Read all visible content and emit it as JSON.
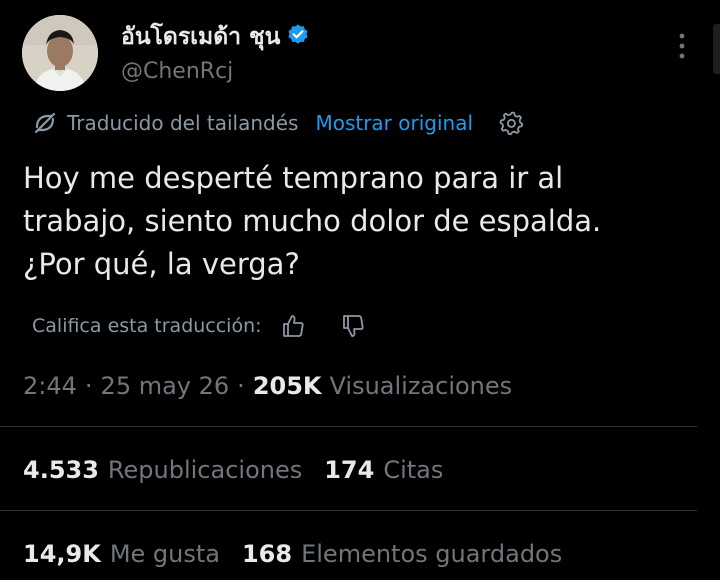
{
  "author": {
    "display_name": "อันโดรเมด้า ชุน",
    "handle": "@ChenRcj",
    "verified": true,
    "avatar_icon": "profile-photo"
  },
  "translation": {
    "translated_from": "Traducido del tailandés",
    "show_original": "Mostrar original",
    "rate_label": "Califica esta traducción:"
  },
  "tweet": {
    "lines": [
      "Hoy me desperté temprano para ir al",
      "trabajo, siento mucho dolor de espalda.",
      "¿Por qué, la verga?"
    ]
  },
  "meta": {
    "time": "2:44",
    "separator": "·",
    "date": "25 may 26",
    "views_count": "205K",
    "views_label": "Visualizaciones"
  },
  "stats": {
    "reposts_count": "4.533",
    "reposts_label": "Republicaciones",
    "quotes_count": "174",
    "quotes_label": "Citas",
    "likes_count": "14,9K",
    "likes_label": "Me gusta",
    "bookmarks_count": "168",
    "bookmarks_label": "Elementos guardados"
  },
  "colors": {
    "background": "#000000",
    "text": "#e7e9ea",
    "secondary_text": "#71767b",
    "accent": "#1d9bf0",
    "divider": "#2f3336"
  }
}
